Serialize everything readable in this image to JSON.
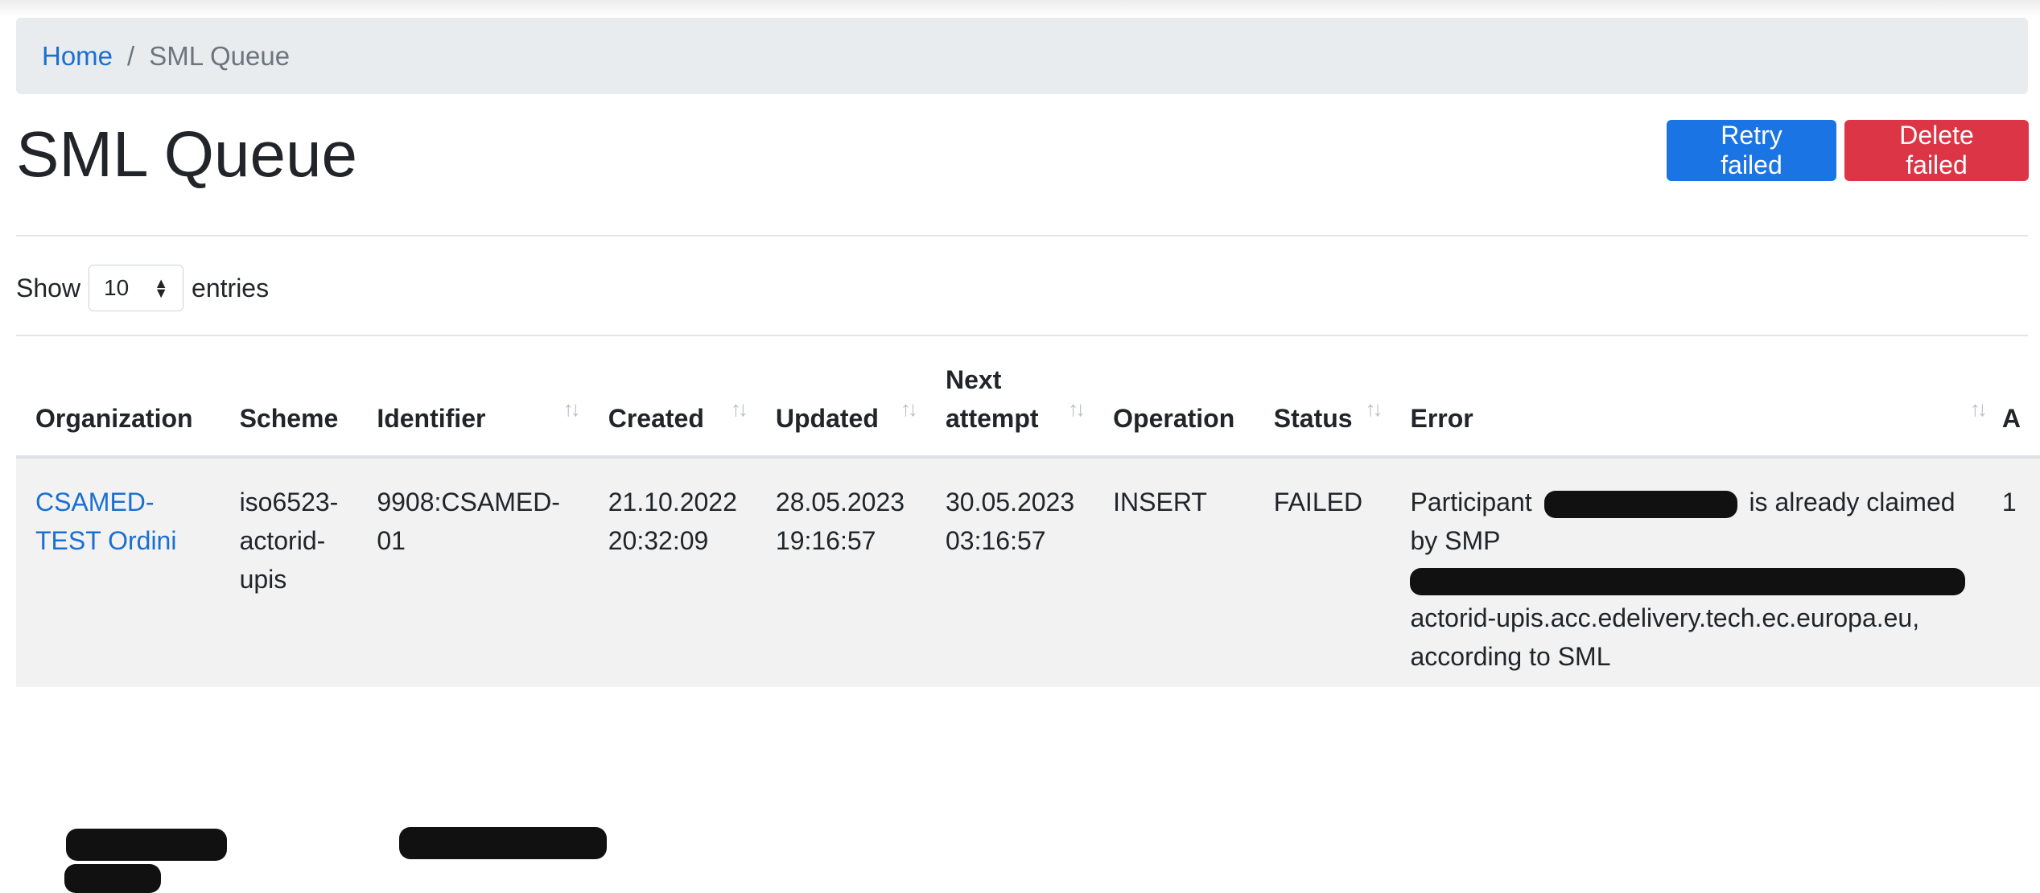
{
  "breadcrumb": {
    "home": "Home",
    "separator": "/",
    "current": "SML Queue"
  },
  "page": {
    "title": "SML Queue"
  },
  "actions": {
    "retry_label": "Retry failed",
    "delete_label": "Delete failed"
  },
  "length_menu": {
    "prefix": "Show",
    "value": "10",
    "suffix": "entries"
  },
  "table": {
    "columns": {
      "organization": "Organization",
      "scheme": "Scheme",
      "identifier": "Identifier",
      "created": "Created",
      "updated": "Updated",
      "next_attempt": "Next attempt",
      "operation": "Operation",
      "status": "Status",
      "error": "Error",
      "next": "A"
    },
    "row": {
      "organization": "CSAMED-TEST Ordini",
      "scheme": "iso6523-actorid-upis",
      "identifier": "9908:CSAMED-01",
      "created": "21.10.2022 20:32:09",
      "updated": "28.05.2023 19:16:57",
      "next_attempt": "30.05.2023 03:16:57",
      "operation": "INSERT",
      "status": "FAILED",
      "error_prefix": "Participant",
      "error_mid": "is already claimed by SMP",
      "error_host_tail": "actorid-upis.acc.edelivery.tech.ec.europa.eu,",
      "error_suffix": "according to SML",
      "next_value": "1"
    }
  }
}
